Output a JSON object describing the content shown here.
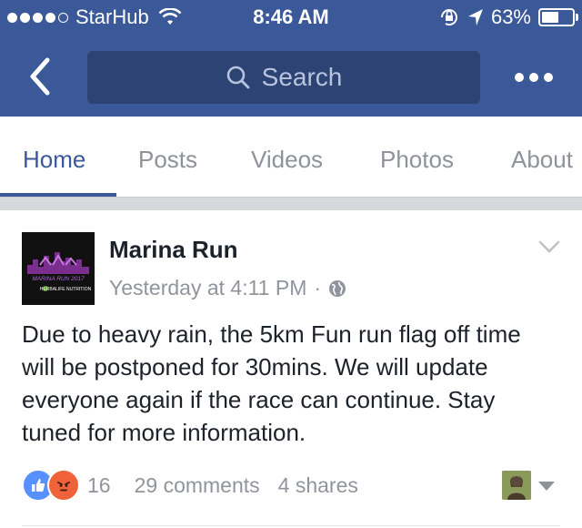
{
  "status_bar": {
    "carrier": "StarHub",
    "time": "8:46 AM",
    "battery": "63%",
    "battery_level": 0.63
  },
  "nav": {
    "back_icon": "chevron-left-icon",
    "search_placeholder": "Search",
    "more_icon": "more-dots-icon"
  },
  "tabs": [
    {
      "label": "Home",
      "active": true
    },
    {
      "label": "Posts"
    },
    {
      "label": "Videos"
    },
    {
      "label": "Photos"
    },
    {
      "label": "About"
    }
  ],
  "post": {
    "page_name": "Marina Run",
    "timestamp": "Yesterday at 4:11 PM",
    "separator": "·",
    "text": "Due to heavy rain, the 5km Fun run flag off time will be postponed for 30mins. We will update everyone again if the race can continue. Stay tuned for more information.",
    "avatar_text": {
      "title": "MARINA RUN 2017",
      "sponsor": "HERBALIFE NUTRITION"
    },
    "reaction_count": "16",
    "comments": "29 comments",
    "shares": "4 shares"
  },
  "colors": {
    "brand": "#3b5998",
    "like": "#5890ff",
    "angry": "#f0623a",
    "muted": "#90949c"
  }
}
